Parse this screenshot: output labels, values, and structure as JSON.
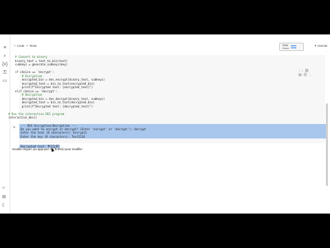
{
  "toolbar": {
    "code_label": "Code",
    "text_label": "Texte",
    "runtime_line1": "RAM",
    "runtime_line2": "Disque",
    "gemini_label": "Gemini"
  },
  "code_lines": [
    {
      "text": "    # Convert to binary",
      "kind": "comment"
    },
    {
      "text": "    binary_text = text_to_bin(text)",
      "kind": "plain"
    },
    {
      "text": "    subkeys = generate_subkeys(key)",
      "kind": "plain"
    },
    {
      "text": "",
      "kind": "plain"
    },
    {
      "text": "    if choice == 'encrypt':",
      "kind": "plain"
    },
    {
      "text": "        # Encryption",
      "kind": "comment"
    },
    {
      "text": "        encrypted_bin = des_encrypt(binary_text, subkeys)",
      "kind": "plain"
    },
    {
      "text": "        encrypted_text = bin_to_text(encrypted_bin)",
      "kind": "plain"
    },
    {
      "text": "        print(f\"Encrypted text: {encrypted_text}\")",
      "kind": "plain"
    },
    {
      "text": "    elif choice == 'decrypt':",
      "kind": "plain"
    },
    {
      "text": "        # Decryption",
      "kind": "comment"
    },
    {
      "text": "        decrypted_bin = des_decrypt(binary_text, subkeys)",
      "kind": "plain"
    },
    {
      "text": "        decrypted_text = bin_to_text(decrypted_bin)",
      "kind": "plain"
    },
    {
      "text": "        print(f\"Decrypted text: {decrypted_text}\")",
      "kind": "plain"
    },
    {
      "text": "",
      "kind": "plain"
    },
    {
      "text": "# Run the interactive DES program",
      "kind": "comment"
    },
    {
      "text": "interactive_des()",
      "kind": "plain"
    }
  ],
  "output_lines": [
    "--- DES Encryption/Decryption ---",
    "Do you want to encrypt or decrypt? (Enter 'encrypt' or 'decrypt'): decrypt",
    "Enter the text (8 characters): Encrypt1",
    "Enter the key (8 characters): Test1234",
    "Decrypted text: ¶t1Ç\u0000Ö["
  ],
  "hint_text": "Double-cliquez (ou appuyez sur Entrée) pour modifier"
}
